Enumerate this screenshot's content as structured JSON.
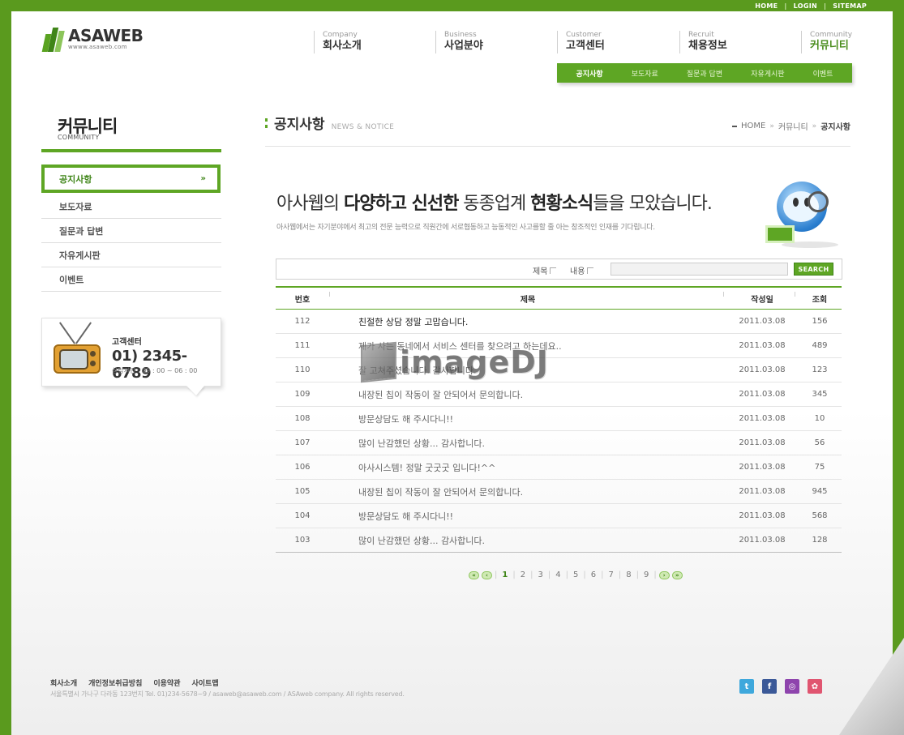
{
  "topbar": {
    "home": "HOME",
    "login": "LOGIN",
    "sitemap": "SITEMAP"
  },
  "logo": {
    "name": "ASAWEB",
    "url": "wwww.asaweb.com"
  },
  "gnb": [
    {
      "en": "Company",
      "ko": "회사소개"
    },
    {
      "en": "Business",
      "ko": "사업분야"
    },
    {
      "en": "Customer",
      "ko": "고객센터"
    },
    {
      "en": "Recruit",
      "ko": "채용정보"
    },
    {
      "en": "Community",
      "ko": "커뮤니티"
    }
  ],
  "subnav": [
    "공지사항",
    "보도자료",
    "질문과 답변",
    "자유게시판",
    "이벤트"
  ],
  "sidebar": {
    "title": "커뮤니티",
    "subtitle": "COMMUNITY",
    "active": "공지사항",
    "items": [
      "보도자료",
      "질문과 답변",
      "자유게시판",
      "이벤트"
    ],
    "cs_label": "고객센터",
    "cs_phone": "01) 2345-6789",
    "cs_hours": "상담시간 : 09 : 00 ~ 06 : 00"
  },
  "page": {
    "title": "공지사항",
    "title_en": "NEWS & NOTICE",
    "breadcrumb": [
      "HOME",
      "커뮤니티",
      "공지사항"
    ]
  },
  "hero": {
    "pre": "아사웹의 ",
    "b1": "다양하고 신선한",
    "mid": " 동종업계 ",
    "b2": "현황소식",
    "post": "들을 모았습니다.",
    "sub": "아사웹에서는 자기분야에서 최고의 전문 능력으로 직원간에 서로협동하고 능동적인 사고를할 줄 아는 창조적인 인재를 기다립니다."
  },
  "search": {
    "opt_title": "제목",
    "opt_content": "내용",
    "button": "SEARCH"
  },
  "board": {
    "headers": {
      "no": "번호",
      "title": "제목",
      "date": "작성일",
      "views": "조회"
    },
    "rows": [
      {
        "no": "112",
        "title": "친절한 상담 정말 고맙습니다.",
        "date": "2011.03.08",
        "views": "156"
      },
      {
        "no": "111",
        "title": "제가 사는 동네에서 서비스 센터를 찾으려고 하는데요..",
        "date": "2011.03.08",
        "views": "489"
      },
      {
        "no": "110",
        "title": "잘 고쳐주셨습니다. 감사합니다.",
        "date": "2011.03.08",
        "views": "123"
      },
      {
        "no": "109",
        "title": "내장된 칩이 작동이 잘 안되어서 문의합니다.",
        "date": "2011.03.08",
        "views": "345"
      },
      {
        "no": "108",
        "title": "방문상담도 해 주시다니!!",
        "date": "2011.03.08",
        "views": "10"
      },
      {
        "no": "107",
        "title": "많이 난감했던 상황... 감사합니다.",
        "date": "2011.03.08",
        "views": "56"
      },
      {
        "no": "106",
        "title": "아사시스템! 정말 굿굿굿 입니다!^^",
        "date": "2011.03.08",
        "views": "75"
      },
      {
        "no": "105",
        "title": "내장된 칩이 작동이 잘 안되어서 문의합니다.",
        "date": "2011.03.08",
        "views": "945"
      },
      {
        "no": "104",
        "title": "방문상담도 해 주시다니!!",
        "date": "2011.03.08",
        "views": "568"
      },
      {
        "no": "103",
        "title": "많이 난감했던 상황... 감사합니다.",
        "date": "2011.03.08",
        "views": "128"
      }
    ]
  },
  "paging": {
    "pages": [
      "1",
      "2",
      "3",
      "4",
      "5",
      "6",
      "7",
      "8",
      "9"
    ],
    "current": "1"
  },
  "watermark": "imageDJ",
  "footer": {
    "links": [
      "회사소개",
      "개인정보취급방침",
      "이용약관",
      "사이트맵"
    ],
    "address": "서울특별시 가나구 다라동 123번지     Tel. 01)234-5678~9 / asaweb@asaweb.com / ASAweb company. All rights reserved."
  },
  "social": [
    {
      "icon": "twitter-icon",
      "glyph": "t",
      "color": "#3ea8dc"
    },
    {
      "icon": "facebook-icon",
      "glyph": "f",
      "color": "#3b5998"
    },
    {
      "icon": "me2day-icon",
      "glyph": "◎",
      "color": "#8e44ad"
    },
    {
      "icon": "blog-icon",
      "glyph": "✿",
      "color": "#e05570"
    }
  ],
  "colors": {
    "brand_green": "#5ea624",
    "dark_green": "#3f8518"
  }
}
